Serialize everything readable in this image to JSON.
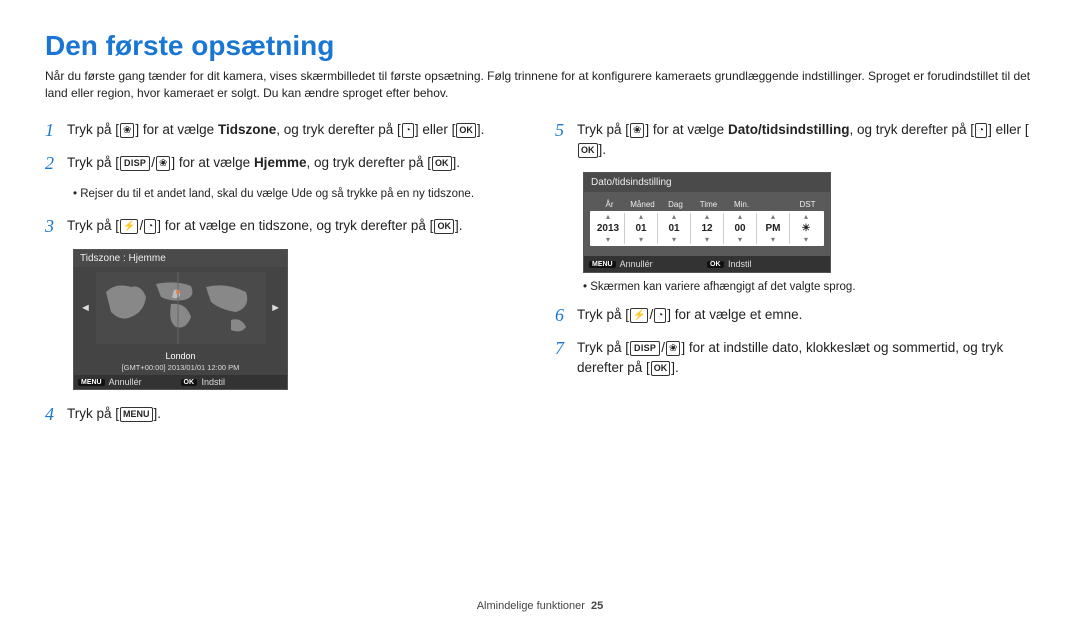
{
  "title": "Den første opsætning",
  "intro": "Når du første gang tænder for dit kamera, vises skærmbilledet til første opsætning. Følg trinnene for at konfigurere kameraets grundlæggende indstillinger. Sproget er forudindstillet til det land eller region, hvor kameraet er solgt. Du kan ændre sproget efter behov.",
  "steps": {
    "s1a": "Tryk på [",
    "s1b": "] for at vælge ",
    "s1c": "Tidszone",
    "s1d": ", og tryk derefter på [",
    "s1e": "] eller [",
    "s1f": "].",
    "s2a": "Tryk på [",
    "s2b": "] for at vælge ",
    "s2c": "Hjemme",
    "s2d": ", og tryk derefter på [",
    "s2e": "].",
    "bullet2": "Rejser du til et andet land, skal du vælge Ude og så trykke på en ny tidszone.",
    "s3a": "Tryk på [",
    "s3b": "] for at vælge en tidszone, og tryk derefter på [",
    "s3c": "].",
    "s4a": "Tryk på [",
    "s4b": "].",
    "s5a": "Tryk på [",
    "s5b": "] for at vælge ",
    "s5c": "Dato/tidsindstilling",
    "s5d": ", og tryk derefter på [",
    "s5e": "] eller [",
    "s5f": "].",
    "note5": "Skærmen kan variere afhængigt af det valgte sprog.",
    "s6a": "Tryk på [",
    "s6b": "] for at vælge et emne.",
    "s7a": "Tryk på [",
    "s7b": "] for at indstille dato, klokkeslæt og sommertid, og tryk derefter på [",
    "s7c": "]."
  },
  "nums": {
    "n1": "1",
    "n2": "2",
    "n3": "3",
    "n4": "4",
    "n5": "5",
    "n6": "6",
    "n7": "7"
  },
  "icons": {
    "disp": "DISP",
    "ok": "OK",
    "menu": "MENU",
    "flower": "❀",
    "timer": "◔",
    "flash": "⚡",
    "slash": "/"
  },
  "timezone": {
    "header": "Tidszone : Hjemme",
    "location": "London",
    "gmt": "[GMT+00:00] 2013/01/01 12:00 PM",
    "cancel": "Annullér",
    "set": "Indstil",
    "menuBtn": "MENU",
    "okBtn": "OK"
  },
  "datebox": {
    "header": "Dato/tidsindstilling",
    "cols": {
      "ar": "År",
      "maned": "Måned",
      "dag": "Dag",
      "time": "Time",
      "min": "Min.",
      "dst": "DST"
    },
    "vals": {
      "ar": "2013",
      "maned": "01",
      "dag": "01",
      "time": "12",
      "min": "00",
      "pm": "PM",
      "dst": "☀"
    },
    "cancel": "Annullér",
    "set": "Indstil",
    "menuBtn": "MENU",
    "okBtn": "OK"
  },
  "footer": {
    "section": "Almindelige funktioner",
    "page": "25"
  }
}
